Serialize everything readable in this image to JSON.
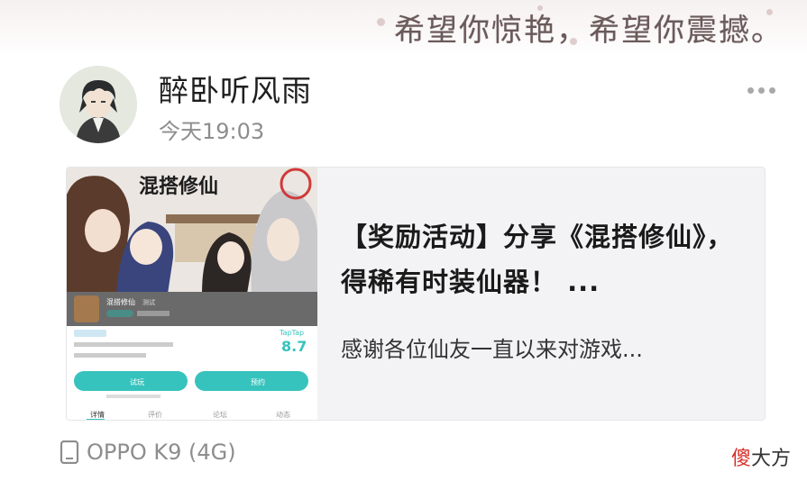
{
  "banner": {
    "text": "希望你惊艳，希望你震撼。"
  },
  "post": {
    "author": "醉卧听风雨",
    "time": "今天19:03",
    "more_icon": "more-dots-icon"
  },
  "card": {
    "title": "【奖励活动】分享《混搭修仙》，得稀有时装仙器！ ...",
    "description": "感谢各位仙友一直以来对游戏...",
    "thumbnail": {
      "game_logo": "混搭修仙",
      "app_name": "混搭修仙",
      "app_tag": "测试",
      "badge_label": "TapTap",
      "rating": "8.7",
      "rating_label": "TapTap",
      "btn_left": "试玩",
      "btn_right": "预约",
      "tabs": [
        "详情",
        "评价",
        "论坛",
        "动态"
      ]
    }
  },
  "footer": {
    "device": "OPPO K9 (4G)",
    "device_icon": "phone-icon",
    "watermark_red": "傻",
    "watermark_black": "大方"
  },
  "colors": {
    "accent_teal": "#37c3bd",
    "muted": "#8d8d8d",
    "card_bg": "#f3f3f5"
  }
}
